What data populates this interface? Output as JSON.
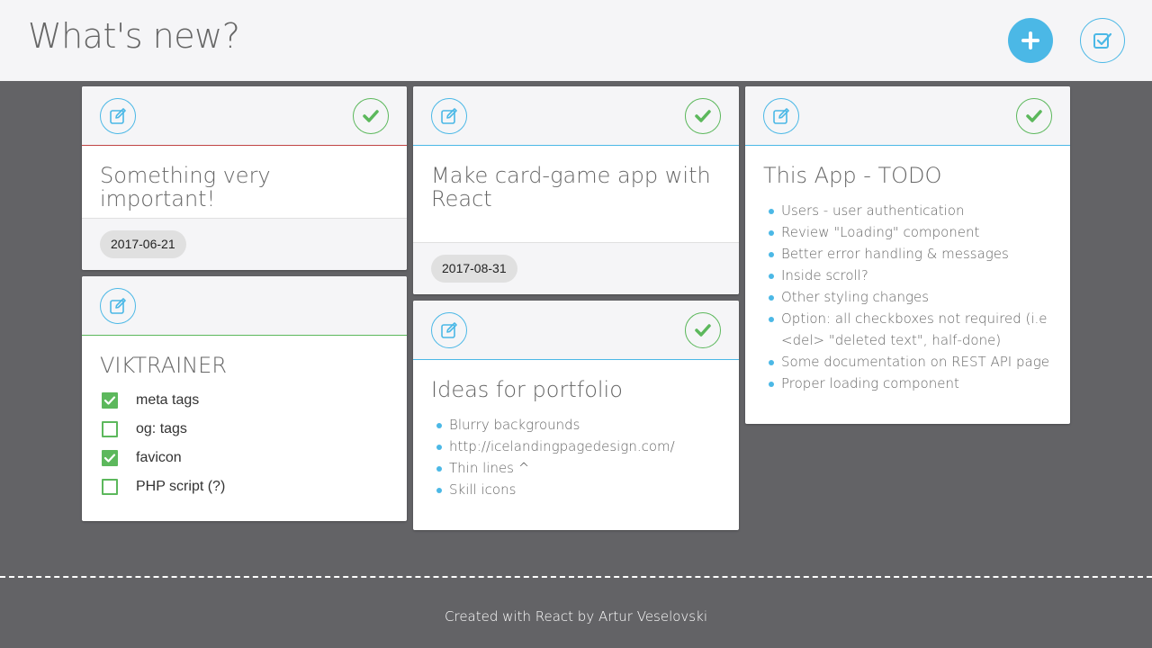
{
  "header": {
    "title": "What's new?",
    "add_icon": "plus-icon",
    "toggle_icon": "checkbox-edit-icon"
  },
  "colors": {
    "accent": "#4bb8e6",
    "done": "#5cb85c",
    "important": "#c14545",
    "background": "#636366",
    "panel": "#f5f5f7"
  },
  "cards": [
    {
      "title": "Something very important!",
      "date": "2017-06-21"
    },
    {
      "title": "VIKTRAINER",
      "checklist": [
        {
          "label": "meta tags",
          "checked": true
        },
        {
          "label": "og: tags",
          "checked": false
        },
        {
          "label": "favicon",
          "checked": true
        },
        {
          "label": "PHP script (?)",
          "checked": false
        }
      ]
    },
    {
      "title": "Make card-game app with React",
      "date": "2017-08-31"
    },
    {
      "title": "Ideas for portfolio",
      "items": [
        "Blurry backgrounds",
        "http://icelandingpagedesign.com/",
        "Thin lines ^",
        "Skill icons"
      ]
    },
    {
      "title": "This App - TODO",
      "items": [
        "Users - user authentication",
        "Review \"Loading\" component",
        "Better error handling & messages",
        "Inside scroll?",
        "Other styling changes",
        "Option: all checkboxes not required (i.e <del> \"deleted text\", half-done)",
        "Some documentation on REST API page",
        "Proper loading component"
      ]
    }
  ],
  "footer": {
    "text": "Created with React by Artur Veselovski"
  }
}
